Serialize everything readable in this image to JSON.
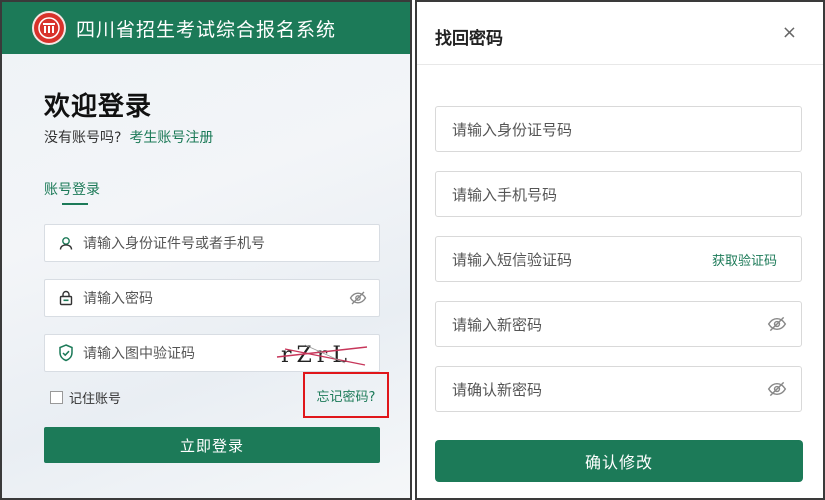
{
  "header": {
    "title": "四川省招生考试综合报名系统",
    "logo_icon": "emblem-icon"
  },
  "login": {
    "welcome": "欢迎登录",
    "no_account": "没有账号吗?",
    "register_link": "考生账号注册",
    "tab_account": "账号登录",
    "id_placeholder": "请输入身份证件号或者手机号",
    "password_placeholder": "请输入密码",
    "captcha_placeholder": "请输入图中验证码",
    "captcha_text": "rZrL",
    "remember_label": "记住账号",
    "forgot_link": "忘记密码?",
    "login_button": "立即登录"
  },
  "reset": {
    "title": "找回密码",
    "close": "×",
    "id_placeholder": "请输入身份证号码",
    "phone_placeholder": "请输入手机号码",
    "sms_placeholder": "请输入短信验证码",
    "get_code": "获取验证码",
    "new_password_placeholder": "请输入新密码",
    "confirm_password_placeholder": "请确认新密码",
    "confirm_button": "确认修改"
  },
  "colors": {
    "brand": "#1c7a58",
    "highlight": "#e0161a",
    "logo": "#d8322b"
  }
}
